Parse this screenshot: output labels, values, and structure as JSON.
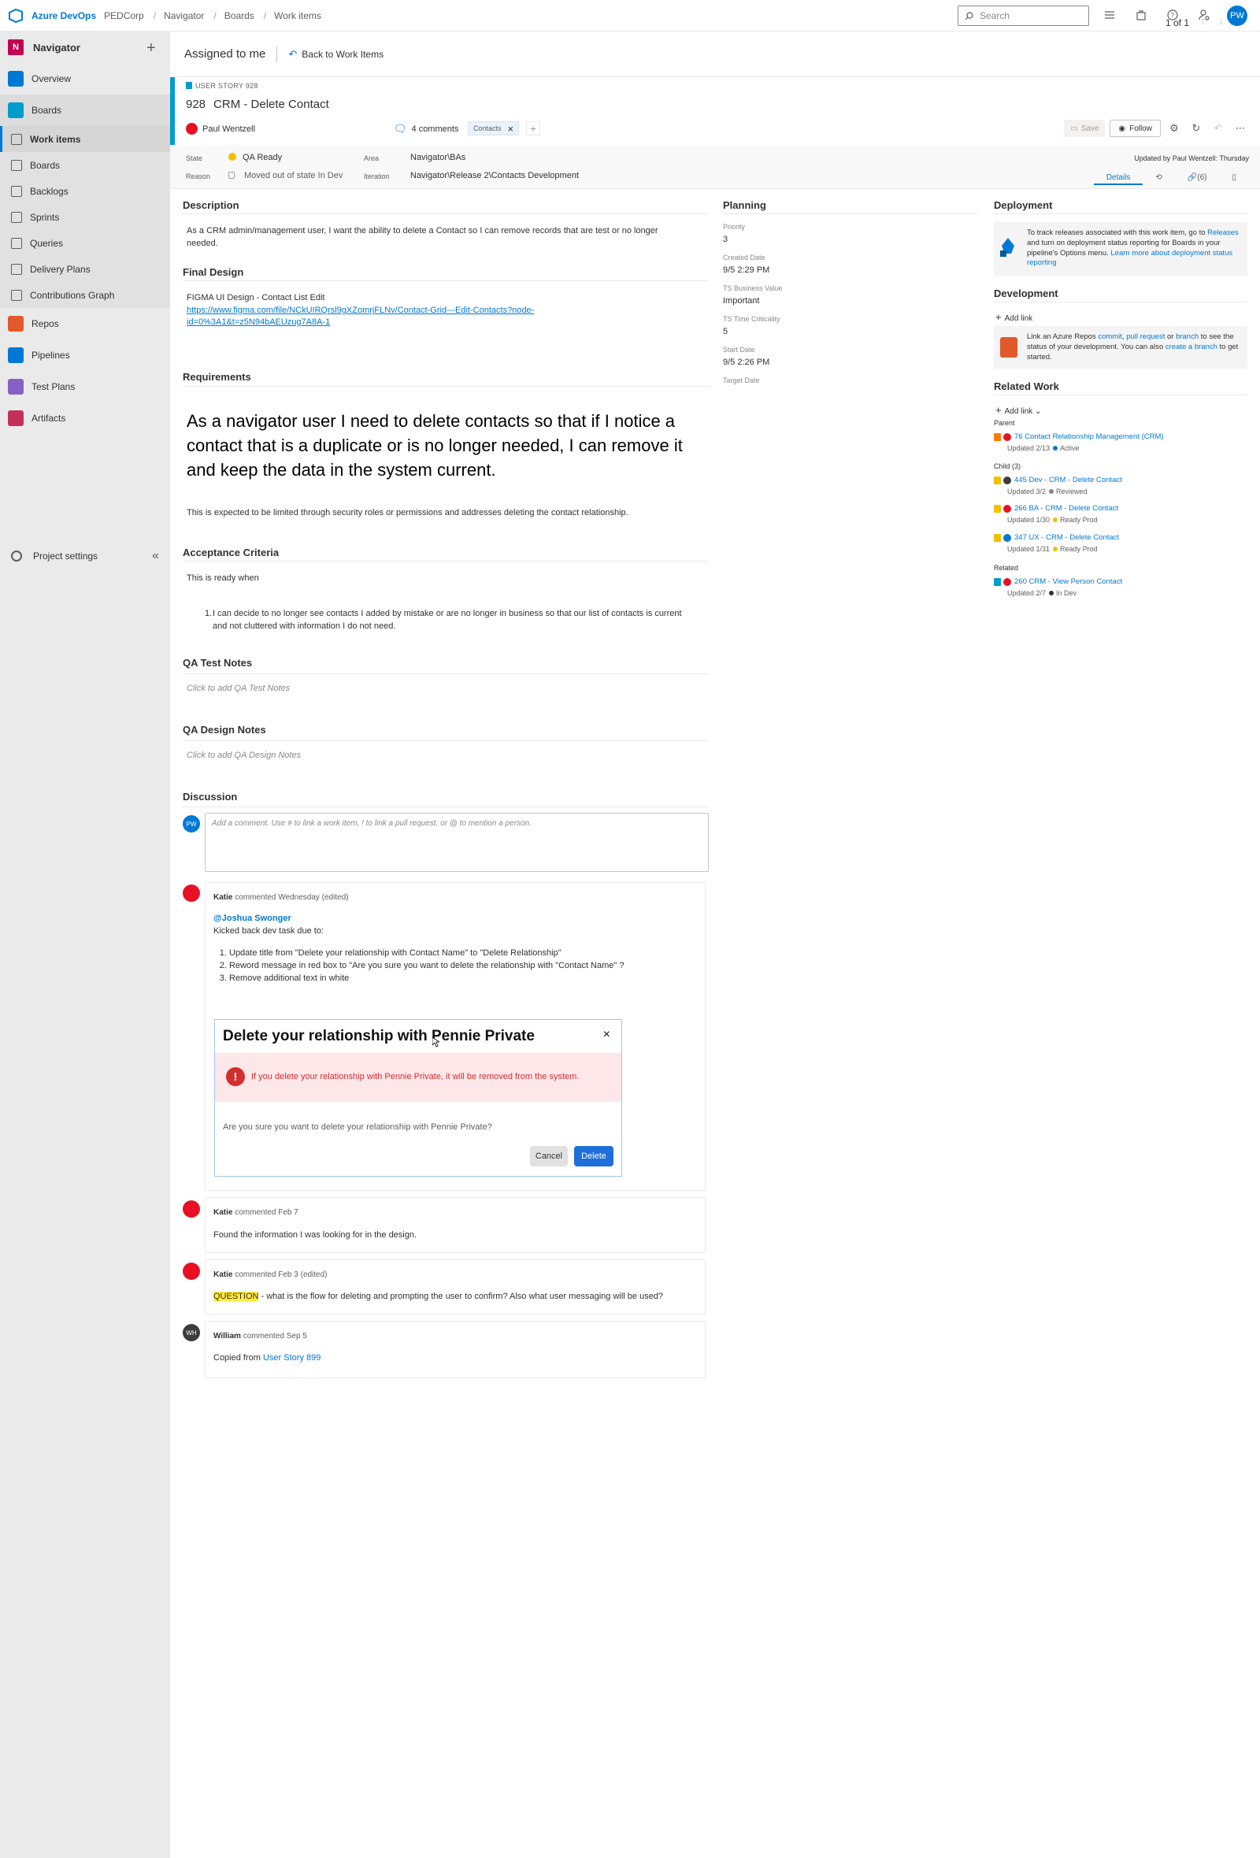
{
  "topbar": {
    "brand": "Azure DevOps",
    "breadcrumbs": [
      "PEDCorp",
      "Navigator",
      "Boards",
      "Work items"
    ],
    "search_placeholder": "Search",
    "user_initials": "PW"
  },
  "sidebar": {
    "project": "Navigator",
    "project_initial": "N",
    "items": [
      {
        "label": "Overview",
        "color": "#0078d4"
      },
      {
        "label": "Boards",
        "color": "#009ccc"
      }
    ],
    "boards_sub": [
      "Work items",
      "Boards",
      "Backlogs",
      "Sprints",
      "Queries",
      "Delivery Plans",
      "Contributions Graph"
    ],
    "more_items": [
      {
        "label": "Repos",
        "color": "#e05a2b"
      },
      {
        "label": "Pipelines",
        "color": "#0078d4"
      },
      {
        "label": "Test Plans",
        "color": "#8661c5"
      },
      {
        "label": "Artifacts",
        "color": "#c3315a"
      }
    ],
    "settings": "Project settings"
  },
  "header": {
    "assigned": "Assigned to me",
    "back": "Back to Work Items",
    "pager": "1 of 1"
  },
  "workitem": {
    "type": "USER STORY 928",
    "number": "928",
    "title": "CRM - Delete Contact",
    "owner": "Paul Wentzell",
    "comments": "4 comments",
    "tag": "Contacts",
    "save": "Save",
    "follow": "Follow"
  },
  "fields": {
    "state_label": "State",
    "state": "QA Ready",
    "reason_label": "Reason",
    "reason": "Moved out of state In Dev",
    "area_label": "Area",
    "area": "Navigator\\BAs",
    "iteration_label": "Iteration",
    "iteration": "Navigator\\Release 2\\Contacts Development",
    "updated": "Updated by Paul Wentzell: Thursday",
    "tabs": [
      "Details",
      "",
      "(6)",
      ""
    ]
  },
  "description": {
    "title": "Description",
    "text": "As a CRM admin/management user, I want the ability to delete a Contact so I can remove records that are test or no longer needed."
  },
  "final_design": {
    "title": "Final Design",
    "text": "FIGMA UI Design - Contact List Edit",
    "url_line1": "https://www.figma.com/file/NCkUIRQrsl9gXZomrjFLNv/Contact-Grid---Edit-Contacts?node-",
    "url_line2": "id=0%3A1&t=z5N94bAEUzug7A8A-1"
  },
  "requirements": {
    "title": "Requirements",
    "big": "As a navigator user I need to delete contacts so that if I notice a contact that is a duplicate or is no longer needed, I can remove it and keep the data in the system current.",
    "note": "This is expected to be limited through security roles or permissions and addresses deleting the contact relationship."
  },
  "acceptance": {
    "title": "Acceptance Criteria",
    "intro": "This is ready when",
    "item": "I can decide to no longer see contacts I added by mistake or are no longer in business so that our list of contacts is current and not cluttered with information I do not need."
  },
  "qa_test": {
    "title": "QA Test Notes",
    "placeholder": "Click to add QA Test Notes"
  },
  "qa_design": {
    "title": "QA Design Notes",
    "placeholder": "Click to add QA Design Notes"
  },
  "discussion": {
    "title": "Discussion",
    "my_initials": "PW",
    "placeholder": "Add a comment. Use # to link a work item, ! to link a pull request, or @ to mention a person.",
    "comments": [
      {
        "author": "Katie",
        "meta": "commented Wednesday (edited)",
        "mention": "@Joshua Swonger",
        "line": "Kicked back dev task due to:",
        "steps": [
          "Update title from \"Delete your relationship with Contact Name\" to \"Delete Relationship\"",
          "Reword message in red box to \"Are you sure you want to delete the relationship with \"Contact Name\" ?",
          "Remove additional text in white"
        ],
        "dialog": {
          "title": "Delete your relationship with Pennie Private",
          "warning": "If you delete your relationship with Pennie Private, it will be removed from the system.",
          "question": "Are you sure you want to delete your relationship with Pennie Private?",
          "cancel": "Cancel",
          "delete": "Delete"
        }
      },
      {
        "author": "Katie",
        "meta": "commented Feb 7",
        "text": "Found the information I was looking for in the design."
      },
      {
        "author": "Katie",
        "meta": "commented Feb 3 (edited)",
        "highlight": "QUESTION",
        "text": " - what is the flow for deleting and prompting the user to confirm? Also what user messaging will be used?"
      },
      {
        "author": "William",
        "initials": "WH",
        "meta": "commented Sep 5",
        "text": "Copied from ",
        "link": "User Story 899"
      }
    ]
  },
  "planning": {
    "title": "Planning",
    "fields": [
      {
        "label": "Priority",
        "value": "3"
      },
      {
        "label": "Created Date",
        "value": "9/5 2:29 PM"
      },
      {
        "label": "TS Business Value",
        "value": "Important"
      },
      {
        "label": "TS Time Criticality",
        "value": "5"
      },
      {
        "label": "Start Date",
        "value": "9/5 2:26 PM"
      },
      {
        "label": "Target Date",
        "value": ""
      }
    ]
  },
  "deployment": {
    "title": "Deployment",
    "t1": "To track releases associated with this work item, go to",
    "t1_link": "Releases",
    "t2": " and turn on deployment status reporting for Boards in your pipeline's Options menu. ",
    "t2_link": "Learn more about deployment status reporting"
  },
  "development": {
    "title": "Development",
    "add_link": "Add link",
    "t1": "Link an Azure Repos ",
    "l1": "commit",
    "l2": "pull request",
    "l3": "branch",
    "t2": " to see the status of your development. You can also ",
    "l4": "create a branch",
    "t3": " to get started."
  },
  "related": {
    "title": "Related Work",
    "add_link": "Add link",
    "parent_label": "Parent",
    "parent": {
      "text": "76 Contact Relationship Management (CRM)",
      "updated": "Updated 2/13",
      "state": "Active",
      "state_color": "#0078d4"
    },
    "child_label": "Child (3)",
    "children": [
      {
        "text": "445 Dev - CRM - Delete Contact",
        "updated": "Updated 3/2",
        "state": "Reviewed",
        "state_color": "#8a8886"
      },
      {
        "text": "266 BA - CRM - Delete Contact",
        "updated": "Updated 1/30",
        "state": "Ready Prod",
        "state_color": "#f2c000"
      },
      {
        "text": "347 UX - CRM - Delete Contact",
        "updated": "Updated 1/31",
        "state": "Ready Prod",
        "state_color": "#f2c000"
      }
    ],
    "related_label": "Related",
    "related_item": {
      "text": "260 CRM - View Person Contact",
      "updated": "Updated 2/7",
      "state": "In Dev",
      "state_color": "#323130"
    }
  }
}
